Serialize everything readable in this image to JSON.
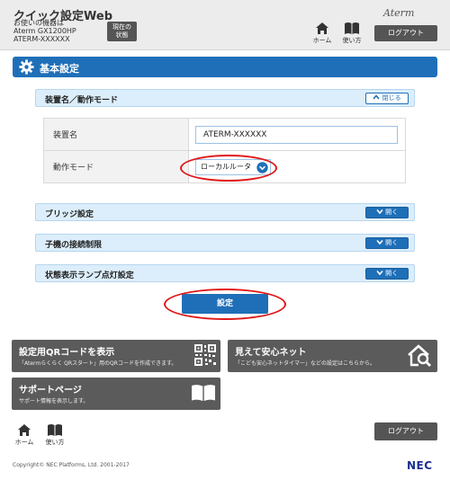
{
  "header": {
    "app_title": "クイック設定Web",
    "device_caption": "お使いの機器は",
    "device_model": "Aterm GX1200HP",
    "device_name": "ATERM-XXXXXX",
    "status_button": [
      "現在の",
      "状態"
    ],
    "brand": "Aterm",
    "nav": {
      "home": "ホーム",
      "manual": "使い方"
    },
    "logout": "ログアウト"
  },
  "page": {
    "title": "基本設定"
  },
  "sections": {
    "device_mode": {
      "label": "装置名／動作モード",
      "toggle": "閉じる"
    },
    "bridge": {
      "label": "ブリッジ設定",
      "toggle": "開く"
    },
    "child_limit": {
      "label": "子機の接続制限",
      "toggle": "開く"
    },
    "lamp": {
      "label": "状態表示ランプ点灯設定",
      "toggle": "開く"
    }
  },
  "form": {
    "device_name": {
      "label": "装置名",
      "value": "ATERM-XXXXXX"
    },
    "mode": {
      "label": "動作モード",
      "value": "ローカルルータ"
    }
  },
  "submit": "設定",
  "tiles": {
    "qr": {
      "title": "設定用QRコードを表示",
      "desc": "「Atermらくらく QRスタート」用のQRコードを作成できます。"
    },
    "safety": {
      "title": "見えて安心ネット",
      "desc": "「こども安心ネットタイマー」などの設定はこちらから。"
    },
    "support": {
      "title": "サポートページ",
      "desc": "サポート情報を表示します。"
    }
  },
  "footer": {
    "nav": {
      "home": "ホーム",
      "manual": "使い方"
    },
    "logout": "ログアウト",
    "copyright": "Copyright© NEC Platforms, Ltd. 2001-2017",
    "logo": "NEC"
  },
  "colors": {
    "accent": "#1f6fb8",
    "section_bg": "#dceefb",
    "tile_bg": "#5b5b5b",
    "annotation": "#e01818"
  }
}
